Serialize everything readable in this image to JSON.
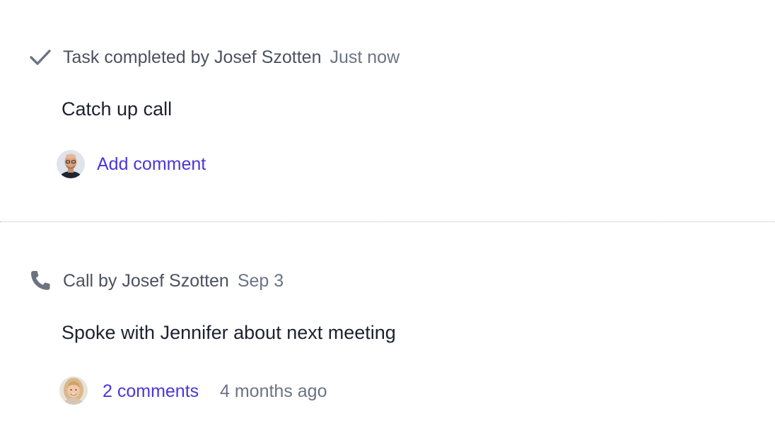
{
  "activities": [
    {
      "icon": "check-icon",
      "header_text": "Task completed by Josef Szotten",
      "time": "Just now",
      "body": "Catch up call",
      "comment_link": "Add comment"
    },
    {
      "icon": "phone-icon",
      "header_text": "Call by Josef Szotten",
      "time": "Sep 3",
      "body": "Spoke with Jennifer about next meeting",
      "comment_link": "2 comments",
      "comment_time": "4 months ago"
    }
  ],
  "colors": {
    "link": "#4a36d9",
    "muted": "#6b7385",
    "icon": "#6b7280"
  }
}
